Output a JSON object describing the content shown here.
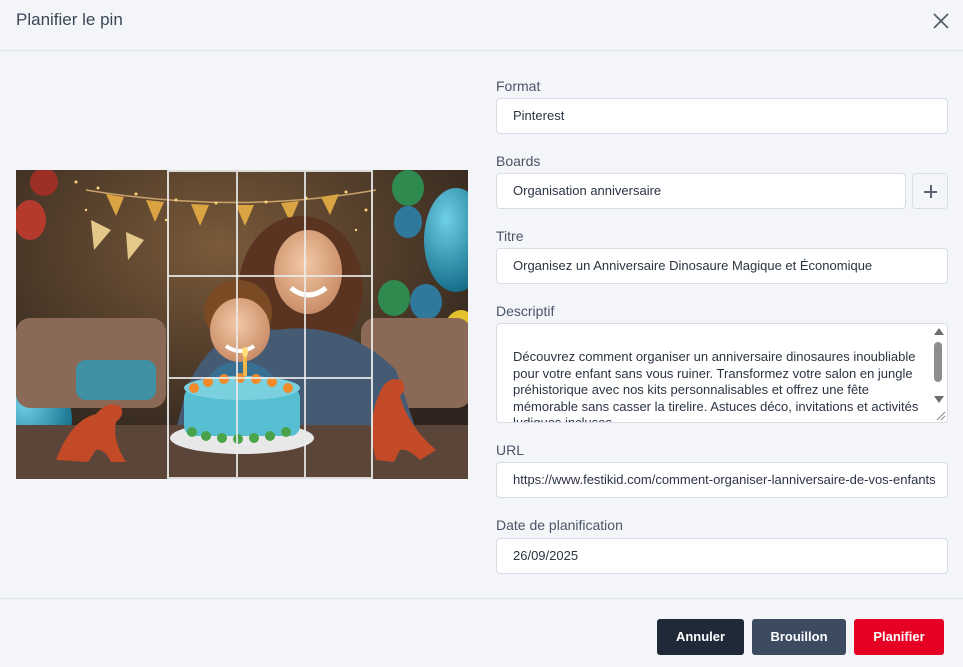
{
  "header": {
    "title": "Planifier le pin",
    "close_icon": "close-icon"
  },
  "form": {
    "format": {
      "label": "Format",
      "value": "Pinterest"
    },
    "boards": {
      "label": "Boards",
      "value": "Organisation anniversaire",
      "add_icon": "plus-icon"
    },
    "titre": {
      "label": "Titre",
      "value": "Organisez un Anniversaire Dinosaure Magique et Économique"
    },
    "descriptif": {
      "label": "Descriptif",
      "value": "Découvrez comment organiser un anniversaire dinosaures inoubliable pour votre enfant sans vous ruiner. Transformez votre salon en jungle préhistorique avec nos kits personnalisables et offrez une fête mémorable sans casser la tirelire. Astuces déco, invitations et activités ludiques incluses."
    },
    "url": {
      "label": "URL",
      "value": "https://www.festikid.com/comment-organiser-lanniversaire-de-vos-enfants"
    },
    "date": {
      "label": "Date de planification",
      "value": "26/09/2025"
    }
  },
  "footer": {
    "annuler": "Annuler",
    "brouillon": "Brouillon",
    "planifier": "Planifier"
  },
  "colors": {
    "annuler_bg": "#1f2937",
    "brouillon_bg": "#3d4b61",
    "planifier_bg": "#e60023"
  }
}
